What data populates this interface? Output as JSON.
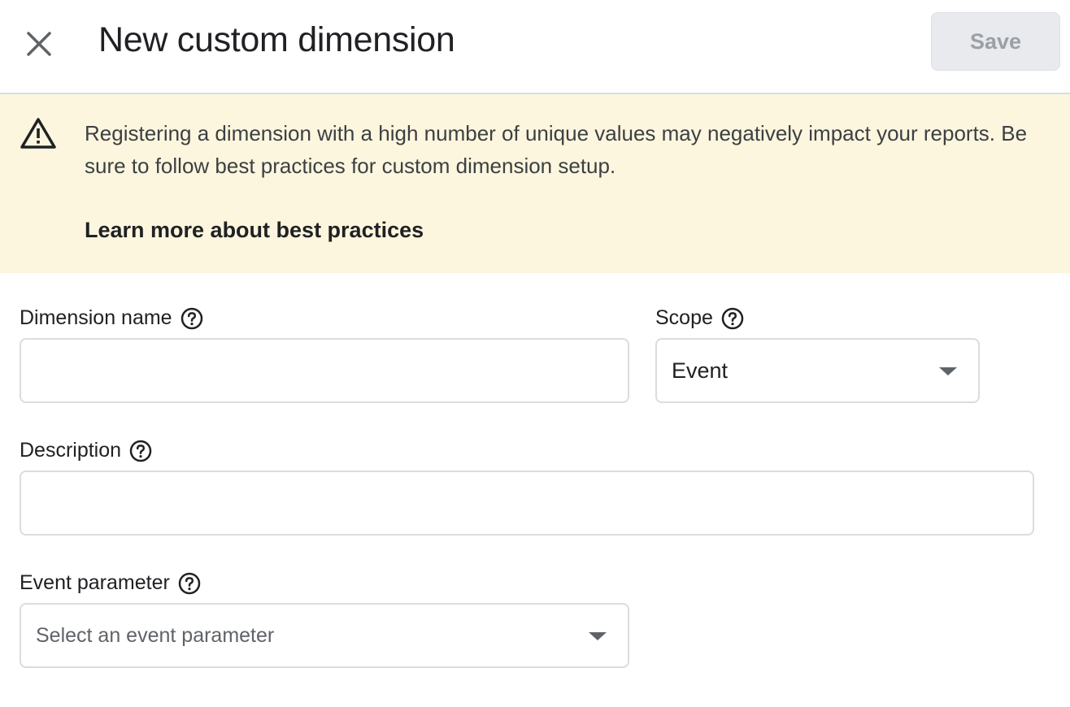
{
  "header": {
    "title": "New custom dimension",
    "save_label": "Save",
    "close_icon": "close-icon"
  },
  "banner": {
    "icon": "warning-icon",
    "message": "Registering a dimension with a high number of unique values may negatively impact your reports. Be sure to follow best practices for custom dimension setup.",
    "link": "Learn more about best practices",
    "background": "#fdf6de"
  },
  "form": {
    "dimension_name": {
      "label": "Dimension name",
      "value": "",
      "placeholder": ""
    },
    "scope": {
      "label": "Scope",
      "selected": "Event"
    },
    "description": {
      "label": "Description",
      "value": "",
      "placeholder": ""
    },
    "event_parameter": {
      "label": "Event parameter",
      "placeholder": "Select an event parameter"
    }
  }
}
